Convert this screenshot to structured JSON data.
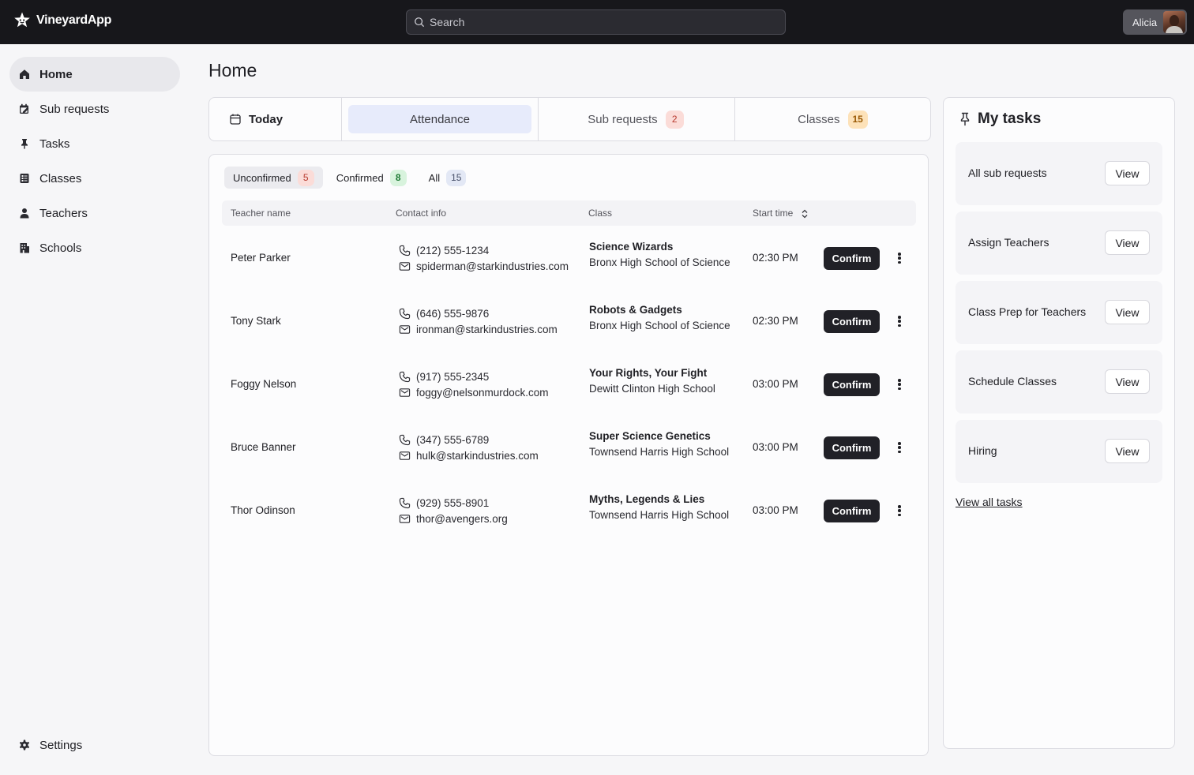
{
  "app": {
    "name": "VineyardApp",
    "user_name": "Alicia"
  },
  "search": {
    "placeholder": "Search"
  },
  "sidebar": {
    "items": [
      {
        "label": "Home",
        "icon": "home-icon",
        "active": true
      },
      {
        "label": "Sub requests",
        "icon": "calendar-edit-icon"
      },
      {
        "label": "Tasks",
        "icon": "pin-icon"
      },
      {
        "label": "Classes",
        "icon": "book-icon"
      },
      {
        "label": "Teachers",
        "icon": "person-icon"
      },
      {
        "label": "Schools",
        "icon": "building-icon"
      }
    ],
    "settings_label": "Settings"
  },
  "page": {
    "title": "Home"
  },
  "tabs": {
    "today": "Today",
    "attendance": "Attendance",
    "sub_requests": {
      "label": "Sub requests",
      "count": "2"
    },
    "classes": {
      "label": "Classes",
      "count": "15"
    }
  },
  "filters": {
    "unconfirmed": {
      "label": "Unconfirmed",
      "count": "5"
    },
    "confirmed": {
      "label": "Confirmed",
      "count": "8"
    },
    "all": {
      "label": "All",
      "count": "15"
    }
  },
  "table": {
    "headers": {
      "name": "Teacher name",
      "contact": "Contact info",
      "class": "Class",
      "start_time": "Start time"
    },
    "confirm_label": "Confirm",
    "rows": [
      {
        "name": "Peter Parker",
        "phone": "(212) 555-1234",
        "email": "spiderman@starkindustries.com",
        "class_title": "Science Wizards",
        "school": "Bronx High School of Science",
        "time": "02:30 PM"
      },
      {
        "name": "Tony Stark",
        "phone": "(646) 555-9876",
        "email": "ironman@starkindustries.com",
        "class_title": "Robots & Gadgets",
        "school": "Bronx High School of Science",
        "time": "02:30 PM"
      },
      {
        "name": "Foggy Nelson",
        "phone": "(917) 555-2345",
        "email": "foggy@nelsonmurdock.com",
        "class_title": "Your Rights, Your Fight",
        "school": "Dewitt Clinton High School",
        "time": "03:00 PM"
      },
      {
        "name": "Bruce Banner",
        "phone": "(347) 555-6789",
        "email": "hulk@starkindustries.com",
        "class_title": "Super Science Genetics",
        "school": "Townsend Harris High School",
        "time": "03:00 PM"
      },
      {
        "name": "Thor Odinson",
        "phone": "(929) 555-8901",
        "email": "thor@avengers.org",
        "class_title": "Myths, Legends & Lies",
        "school": "Townsend Harris High School",
        "time": "03:00 PM"
      }
    ]
  },
  "tasks": {
    "title": "My tasks",
    "view_label": "View",
    "items": [
      {
        "label": "All sub requests"
      },
      {
        "label": "Assign Teachers"
      },
      {
        "label": "Class Prep for Teachers"
      },
      {
        "label": "Schedule Classes"
      },
      {
        "label": "Hiring"
      }
    ],
    "view_all": "View all tasks"
  },
  "colors": {
    "topbar": "#17171b",
    "active_tab": "#e7ebfb",
    "primary_button": "#212127",
    "badge_red": "#fbdcd8",
    "badge_orange": "#fde2b9",
    "badge_green": "#d8f3dd"
  }
}
